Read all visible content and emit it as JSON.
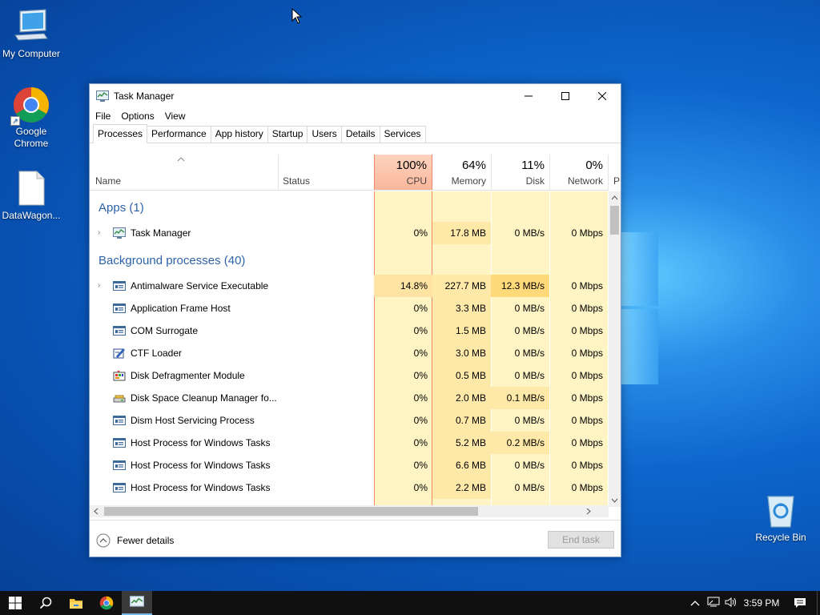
{
  "desktop": {
    "icons": [
      {
        "label": "My Computer"
      },
      {
        "label": "Google Chrome"
      },
      {
        "label": "DataWagon..."
      },
      {
        "label": "Recycle Bin"
      }
    ]
  },
  "window": {
    "title": "Task Manager",
    "menu": [
      "File",
      "Options",
      "View"
    ],
    "tabs": [
      "Processes",
      "Performance",
      "App history",
      "Startup",
      "Users",
      "Details",
      "Services"
    ],
    "active_tab": "Processes"
  },
  "columns": {
    "name": "Name",
    "status": "Status",
    "cpu": {
      "pct": "100%",
      "label": "CPU"
    },
    "memory": {
      "pct": "64%",
      "label": "Memory"
    },
    "disk": {
      "pct": "11%",
      "label": "Disk"
    },
    "network": {
      "pct": "0%",
      "label": "Network"
    },
    "power": "P"
  },
  "groups": {
    "apps": "Apps (1)",
    "background": "Background processes (40)"
  },
  "apps": [
    {
      "name": "Task Manager",
      "cpu": "0%",
      "memory": "17.8 MB",
      "disk": "0 MB/s",
      "network": "0 Mbps",
      "icon": "task-manager-icon"
    }
  ],
  "background": [
    {
      "name": "Antimalware Service Executable",
      "cpu": "14.8%",
      "memory": "227.7 MB",
      "disk": "12.3 MB/s",
      "network": "0 Mbps",
      "icon": "service-icon"
    },
    {
      "name": "Application Frame Host",
      "cpu": "0%",
      "memory": "3.3 MB",
      "disk": "0 MB/s",
      "network": "0 Mbps",
      "icon": "service-icon"
    },
    {
      "name": "COM Surrogate",
      "cpu": "0%",
      "memory": "1.5 MB",
      "disk": "0 MB/s",
      "network": "0 Mbps",
      "icon": "service-icon"
    },
    {
      "name": "CTF Loader",
      "cpu": "0%",
      "memory": "3.0 MB",
      "disk": "0 MB/s",
      "network": "0 Mbps",
      "icon": "ctf-icon"
    },
    {
      "name": "Disk Defragmenter Module",
      "cpu": "0%",
      "memory": "0.5 MB",
      "disk": "0 MB/s",
      "network": "0 Mbps",
      "icon": "defrag-icon"
    },
    {
      "name": "Disk Space Cleanup Manager fo...",
      "cpu": "0%",
      "memory": "2.0 MB",
      "disk": "0.1 MB/s",
      "network": "0 Mbps",
      "icon": "cleanup-icon"
    },
    {
      "name": "Dism Host Servicing Process",
      "cpu": "0%",
      "memory": "0.7 MB",
      "disk": "0 MB/s",
      "network": "0 Mbps",
      "icon": "service-icon"
    },
    {
      "name": "Host Process for Windows Tasks",
      "cpu": "0%",
      "memory": "5.2 MB",
      "disk": "0.2 MB/s",
      "network": "0 Mbps",
      "icon": "service-icon"
    },
    {
      "name": "Host Process for Windows Tasks",
      "cpu": "0%",
      "memory": "6.6 MB",
      "disk": "0 MB/s",
      "network": "0 Mbps",
      "icon": "service-icon"
    },
    {
      "name": "Host Process for Windows Tasks",
      "cpu": "0%",
      "memory": "2.2 MB",
      "disk": "0 MB/s",
      "network": "0 Mbps",
      "icon": "service-icon"
    }
  ],
  "footer": {
    "fewer_details": "Fewer details",
    "end_task": "End task"
  },
  "taskbar": {
    "clock": "3:59 PM"
  },
  "colors": {
    "cpu_header": "#fbb79c",
    "cell_light": "#fff4c4",
    "cell_mid": "#ffe9a8",
    "group_text": "#2e63a8"
  }
}
